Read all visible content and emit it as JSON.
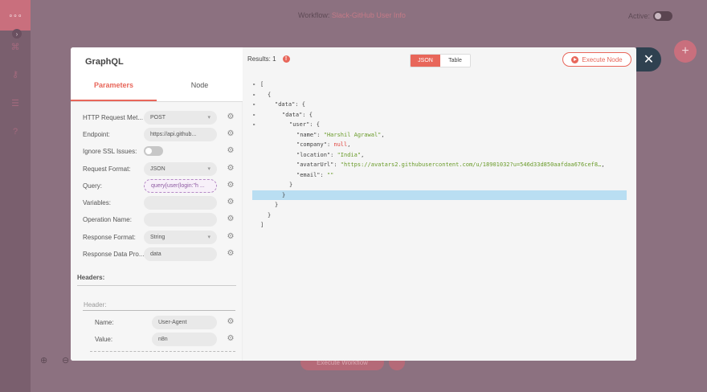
{
  "background": {
    "workflow_label": "Workflow:",
    "workflow_name": "Slack-GitHub User Info",
    "active_label": "Active:",
    "execute_workflow_label": "Execute Workflow"
  },
  "modal": {
    "title": "GraphQL",
    "tabs": [
      {
        "label": "Parameters"
      },
      {
        "label": "Node"
      }
    ],
    "fields": {
      "http_method": {
        "label": "HTTP Request Met...",
        "value": "POST"
      },
      "endpoint": {
        "label": "Endpoint:",
        "value": "https://api.github..."
      },
      "ignore_ssl": {
        "label": "Ignore SSL Issues:"
      },
      "request_format": {
        "label": "Request Format:",
        "value": "JSON"
      },
      "query": {
        "label": "Query:",
        "value": "query{user(login:\"h ..."
      },
      "variables": {
        "label": "Variables:",
        "value": ""
      },
      "operation_name": {
        "label": "Operation Name:",
        "value": ""
      },
      "response_format": {
        "label": "Response Format:",
        "value": "String"
      },
      "response_data_prop": {
        "label": "Response Data Pro...",
        "value": "data"
      }
    },
    "headers": {
      "title": "Headers:",
      "subtitle": "Header:",
      "name": {
        "label": "Name:",
        "value": "User-Agent"
      },
      "value": {
        "label": "Value:",
        "value": "n8n"
      }
    }
  },
  "output": {
    "results_label": "Results: 1",
    "info_symbol": "!",
    "view_json": "JSON",
    "view_table": "Table",
    "execute_node": "Execute Node",
    "json_lines": [
      {
        "indent": 0,
        "toggle": "-",
        "text": "[",
        "parts": []
      },
      {
        "indent": 1,
        "toggle": "-",
        "text": "{",
        "parts": []
      },
      {
        "indent": 2,
        "toggle": "-",
        "key": "\"data\"",
        "text": ": {"
      },
      {
        "indent": 3,
        "toggle": "-",
        "key": "\"data\"",
        "text": ": {"
      },
      {
        "indent": 4,
        "toggle": "-",
        "key": "\"user\"",
        "text": ": {"
      },
      {
        "indent": 5,
        "key": "\"name\"",
        "str": "\"Harshil Agrawal\"",
        "text": ","
      },
      {
        "indent": 5,
        "key": "\"company\"",
        "num": "null",
        "text": ","
      },
      {
        "indent": 5,
        "key": "\"location\"",
        "str": "\"India\"",
        "text": ","
      },
      {
        "indent": 5,
        "key": "\"avatarUrl\"",
        "str": "\"https://avatars2.githubusercontent.com/u/18901032?u=546d33d850aafdaa676cef8…",
        "text": ","
      },
      {
        "indent": 5,
        "key": "\"email\"",
        "str": "\"\"",
        "text": ""
      },
      {
        "indent": 4,
        "text": "}"
      },
      {
        "indent": 3,
        "text": "}",
        "highlight": true
      },
      {
        "indent": 2,
        "text": "}"
      },
      {
        "indent": 1,
        "text": "}"
      },
      {
        "indent": 0,
        "text": "]"
      }
    ]
  },
  "icons": {
    "close": "✕",
    "gear": "⚙",
    "chevron": "▾"
  }
}
